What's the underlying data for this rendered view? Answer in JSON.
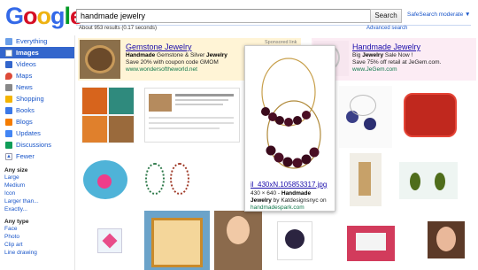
{
  "header": {
    "logo_letters": [
      "G",
      "o",
      "o",
      "g",
      "l",
      "e"
    ],
    "logo_colors": [
      "#3369e8",
      "#d50f25",
      "#eeb211",
      "#3369e8",
      "#009925",
      "#d50f25"
    ],
    "query": "handmade jewelry",
    "search_button": "Search",
    "safesearch": "SafeSearch moderate ▼",
    "results_stats": "About 953 results (0.17 seconds)",
    "advanced_search": "Advanced search"
  },
  "sidebar": {
    "items": [
      {
        "label": "Everything",
        "icon": "everything-icon",
        "color": "#6a9fe9"
      },
      {
        "label": "Images",
        "icon": "images-icon",
        "color": "#ffffff"
      },
      {
        "label": "Videos",
        "icon": "videos-icon",
        "color": "#3366cc"
      },
      {
        "label": "Maps",
        "icon": "maps-icon",
        "color": "#dd4b39"
      },
      {
        "label": "News",
        "icon": "news-icon",
        "color": "#888888"
      },
      {
        "label": "Shopping",
        "icon": "shopping-icon",
        "color": "#f4b400"
      },
      {
        "label": "Books",
        "icon": "books-icon",
        "color": "#3b78e7"
      },
      {
        "label": "Blogs",
        "icon": "blogs-icon",
        "color": "#f57c00"
      },
      {
        "label": "Updates",
        "icon": "updates-icon",
        "color": "#4285f4"
      },
      {
        "label": "Discussions",
        "icon": "discussions-icon",
        "color": "#0f9d58"
      },
      {
        "label": "Fewer",
        "icon": "fewer-icon",
        "color": "#3366cc"
      }
    ],
    "size_heading": "Any size",
    "size_options": [
      "Large",
      "Medium",
      "Icon",
      "Larger than...",
      "Exactly..."
    ],
    "type_heading": "Any type",
    "type_options": [
      "Face",
      "Photo",
      "Clip art",
      "Line drawing"
    ]
  },
  "ads": {
    "sponsored_label": "Sponsored link",
    "ad1": {
      "title": "Gemstone Jewelry",
      "line1_bold": "Handmade",
      "line1_rest": " Gemstone & Silver ",
      "line1_bold2": "Jewelry",
      "line2": "Save 20% with coupon code GMOM",
      "url": "www.wondersoftheworld.net"
    },
    "ad2": {
      "title": "Handmade Jewelry",
      "line1_pre": "Big ",
      "line1_bold": "Jewelry",
      "line1_rest": " Sale Now !",
      "line2": "Save 75% off retail at JeGem.com.",
      "url": "www.JeGem.com"
    }
  },
  "hover_card": {
    "filename": "il_430xN.105853317.jpg",
    "dims": "430 × 640 - ",
    "desc_bold1": "Handmade",
    "desc_bold2": "Jewelry",
    "desc_rest": " by Katdesignsnyc on",
    "source": "handmadespark.com"
  }
}
